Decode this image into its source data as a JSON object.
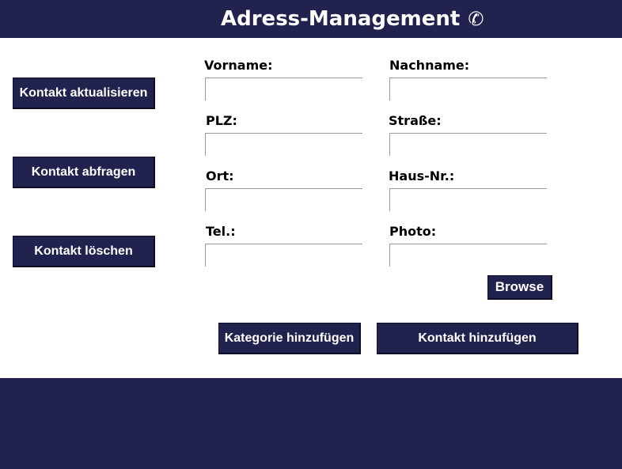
{
  "header": {
    "title": "Adress-Management",
    "icon": "phone-icon",
    "icon_glyph": "✆"
  },
  "sidebar": {
    "update_label": "Kontakt aktualisieren",
    "query_label": "Kontakt abfragen",
    "delete_label": "Kontakt löschen"
  },
  "form": {
    "firstname": {
      "label": "Vorname:",
      "value": ""
    },
    "lastname": {
      "label": "Nachname:",
      "value": ""
    },
    "zip": {
      "label": "PLZ:",
      "value": ""
    },
    "street": {
      "label": "Straße:",
      "value": ""
    },
    "city": {
      "label": "Ort:",
      "value": ""
    },
    "housenumber": {
      "label": "Haus-Nr.:",
      "value": ""
    },
    "phone": {
      "label": "Tel.:",
      "value": ""
    },
    "photo": {
      "label": "Photo:",
      "value": ""
    }
  },
  "actions": {
    "browse_label": "Browse",
    "add_category_label": "Kategorie hinzufügen",
    "add_contact_label": "Kontakt hinzufügen"
  },
  "colors": {
    "primary": "#22224e",
    "background": "#ffffff",
    "text_light": "#ffffff",
    "text_dark": "#000000"
  }
}
